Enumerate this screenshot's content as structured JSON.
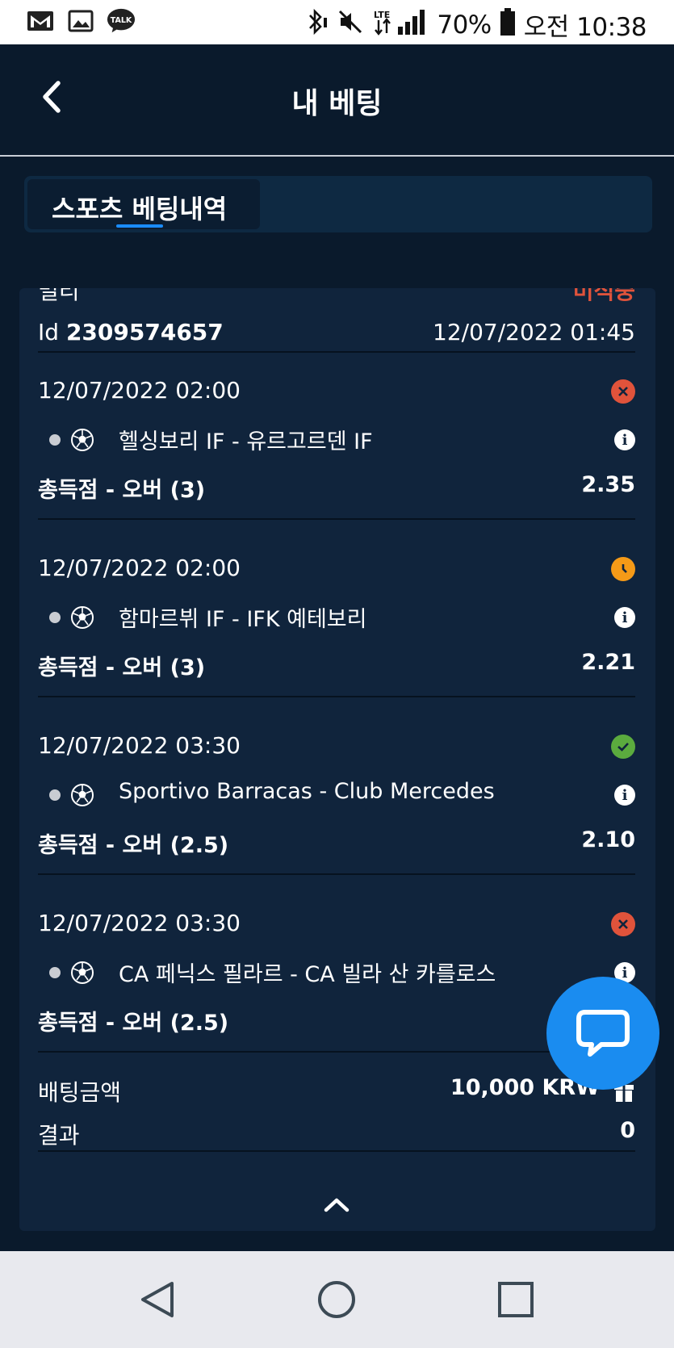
{
  "status_bar": {
    "battery": "70%",
    "time": "오전 10:38",
    "left_icons": [
      "gmail-icon",
      "gallery-icon",
      "kakaotalk-icon"
    ],
    "kakao_label": "TALK",
    "lte_label": "LTE"
  },
  "header": {
    "title": "내 베팅"
  },
  "tabs": [
    {
      "label": "스포츠 베팅내역",
      "active": true
    }
  ],
  "bet": {
    "type": "멀티",
    "status": "미적중",
    "id_label": "Id",
    "id": "2309574657",
    "placed_at": "12/07/2022 01:45",
    "selections": [
      {
        "time": "12/07/2022 02:00",
        "status": "lost",
        "match": "헬싱보리 IF - 유르고르덴 IF",
        "market": "총득점 - 오버 (3)",
        "odds": "2.35"
      },
      {
        "time": "12/07/2022 02:00",
        "status": "pending",
        "match": "함마르뷔 IF - IFK 예테보리",
        "market": "총득점 - 오버 (3)",
        "odds": "2.21"
      },
      {
        "time": "12/07/2022 03:30",
        "status": "won",
        "match": "Sportivo Barracas - Club Mercedes",
        "market": "총득점 - 오버 (2.5)",
        "odds": "2.10"
      },
      {
        "time": "12/07/2022 03:30",
        "status": "lost",
        "match": "CA 페닉스 필라르 - CA 빌라 산 카를로스",
        "market": "총득점 - 오버 (2.5)",
        "odds": ""
      }
    ],
    "stake_label": "배팅금액",
    "stake": "10,000 KRW",
    "result_label": "결과",
    "result": "0"
  },
  "colors": {
    "lost": "#e0533b",
    "pending": "#f59a17",
    "won": "#5bab3e",
    "accent": "#1a8cff"
  }
}
